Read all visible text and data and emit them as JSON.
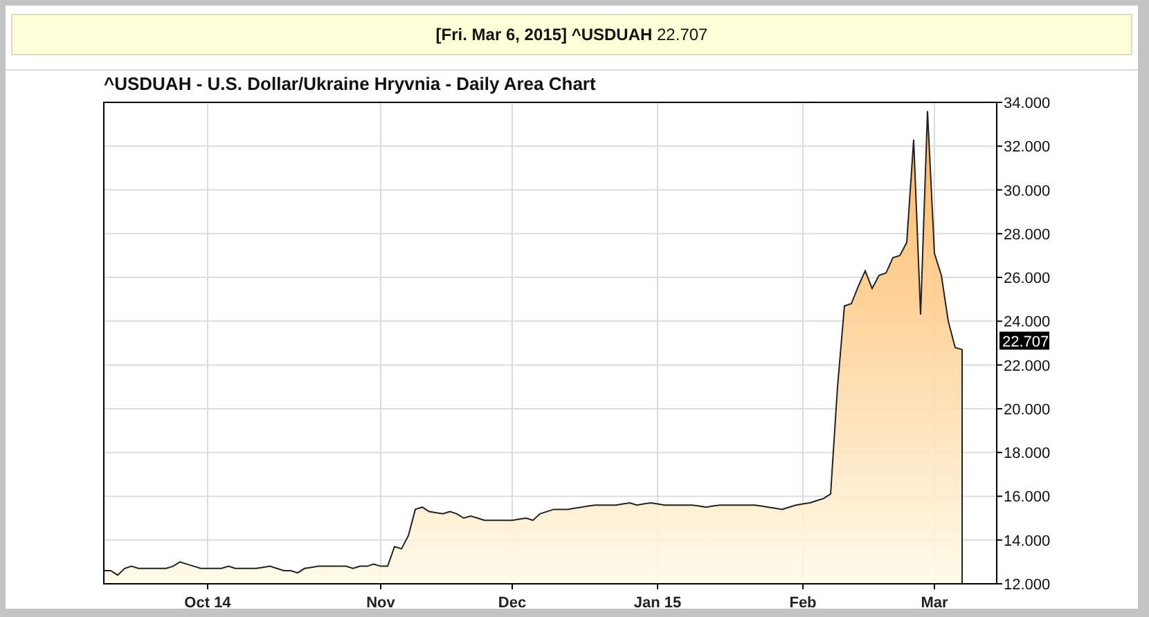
{
  "banner": {
    "text": "**[Fri. Mar 6, 2015] ^USDUAH** 22.707"
  },
  "chart": {
    "last_value_label": "22.707",
    "chart_data": {
      "type": "area",
      "title": "^USDUAH - U.S. Dollar/Ukraine Hryvnia - Daily Area Chart",
      "categories": [
        null,
        null,
        null,
        null,
        null,
        null,
        null,
        null,
        null,
        null,
        null,
        null,
        null,
        null,
        null,
        "Oct 14",
        null,
        null,
        null,
        null,
        null,
        null,
        null,
        null,
        null,
        null,
        null,
        null,
        null,
        null,
        null,
        null,
        null,
        null,
        null,
        null,
        null,
        null,
        null,
        null,
        "Nov",
        null,
        null,
        null,
        null,
        null,
        null,
        null,
        null,
        null,
        null,
        null,
        null,
        null,
        null,
        null,
        null,
        null,
        null,
        "Dec",
        null,
        null,
        null,
        null,
        null,
        null,
        null,
        null,
        null,
        null,
        null,
        null,
        null,
        null,
        null,
        null,
        null,
        null,
        null,
        null,
        "Jan 15",
        null,
        null,
        null,
        null,
        null,
        null,
        null,
        null,
        null,
        null,
        null,
        null,
        null,
        null,
        null,
        null,
        null,
        null,
        null,
        null,
        "Feb",
        null,
        null,
        null,
        null,
        null,
        null,
        null,
        null,
        null,
        null,
        null,
        null,
        null,
        null,
        null,
        null,
        null,
        null,
        "Mar",
        null,
        null,
        null,
        null
      ],
      "series": [
        {
          "color": "#ffad50",
          "values": [
            12.6,
            12.6,
            12.4,
            12.7,
            12.8,
            12.7,
            12.7,
            12.7,
            12.7,
            12.7,
            12.8,
            13.0,
            12.9,
            12.8,
            12.7,
            12.7,
            12.7,
            12.7,
            12.8,
            12.7,
            12.7,
            12.7,
            12.7,
            12.75,
            12.8,
            12.7,
            12.6,
            12.6,
            12.5,
            12.7,
            12.75,
            12.8,
            12.8,
            12.8,
            12.8,
            12.8,
            12.7,
            12.8,
            12.8,
            12.9,
            12.8,
            12.8,
            13.7,
            13.6,
            14.2,
            15.4,
            15.5,
            15.3,
            15.25,
            15.2,
            15.3,
            15.2,
            15.0,
            15.1,
            15.0,
            14.9,
            14.9,
            14.9,
            14.9,
            14.9,
            14.95,
            15.0,
            14.9,
            15.2,
            15.3,
            15.4,
            15.4,
            15.4,
            15.45,
            15.5,
            15.55,
            15.6,
            15.6,
            15.6,
            15.6,
            15.65,
            15.7,
            15.6,
            15.65,
            15.7,
            15.65,
            15.6,
            15.6,
            15.6,
            15.6,
            15.6,
            15.55,
            15.5,
            15.55,
            15.6,
            15.6,
            15.6,
            15.6,
            15.6,
            15.6,
            15.55,
            15.5,
            15.45,
            15.4,
            15.5,
            15.6,
            15.65,
            15.7,
            15.8,
            15.9,
            16.1,
            21.0,
            24.7,
            24.8,
            25.6,
            26.3,
            25.5,
            26.1,
            26.2,
            26.9,
            27.0,
            27.6,
            32.3,
            24.3,
            33.6,
            27.1,
            26.1,
            24.0,
            22.8,
            22.7
          ]
        }
      ],
      "ylim": [
        12,
        34
      ],
      "grid": true,
      "yticks": [
        {
          "value": 12,
          "label": "12.000"
        },
        {
          "value": 14,
          "label": "14.000"
        },
        {
          "value": 16,
          "label": "16.000"
        },
        {
          "value": 18,
          "label": "18.000"
        },
        {
          "value": 20,
          "label": "20.000"
        },
        {
          "value": 22,
          "label": "22.000"
        },
        {
          "value": 24,
          "label": "24.000"
        },
        {
          "value": 26,
          "label": "26.000"
        },
        {
          "value": 28,
          "label": "28.000"
        },
        {
          "value": 30,
          "label": "30.000"
        },
        {
          "value": 32,
          "label": "32.000"
        },
        {
          "value": 34,
          "label": "34.000"
        }
      ]
    }
  }
}
